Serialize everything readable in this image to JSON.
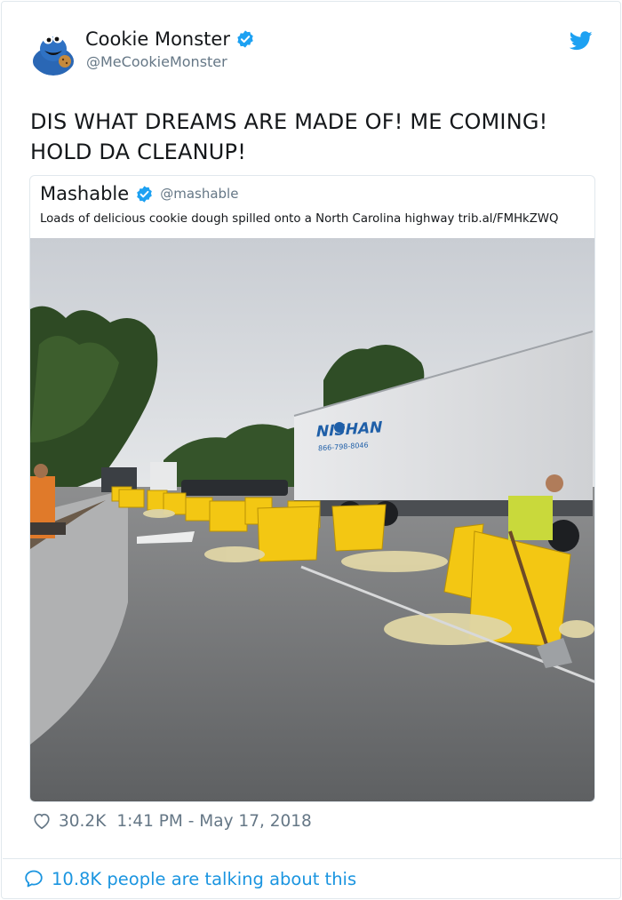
{
  "tweet": {
    "author": {
      "display_name": "Cookie Monster",
      "handle": "@MeCookieMonster",
      "verified": true,
      "avatar_icon": "cookie-monster-avatar"
    },
    "text_line1": "DIS WHAT DREAMS ARE MADE OF! ME COMING!",
    "text_line2": "HOLD DA CLEANUP!",
    "likes": "30.2K",
    "timestamp": "1:41 PM - May 17, 2018",
    "talking_text": "10.8K people are talking about this"
  },
  "quoted_tweet": {
    "display_name": "Mashable",
    "handle": "@mashable",
    "verified": true,
    "text": "Loads of delicious cookie dough spilled onto a North Carolina highway trib.al/FMHkZWQ",
    "photo": {
      "truck_brand": "NISHAN",
      "truck_phone": "866-798-8046"
    }
  },
  "colors": {
    "brand_blue": "#1da1f2",
    "link_blue": "#1b95e0",
    "text_gray": "#657786",
    "border": "#e1e8ed"
  }
}
